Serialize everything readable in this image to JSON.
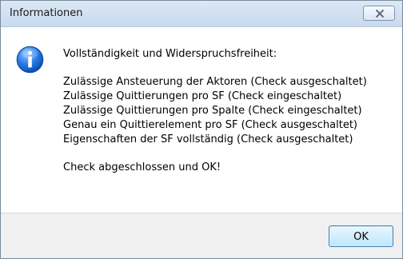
{
  "window": {
    "title": "Informationen"
  },
  "message": {
    "heading": "Vollständigkeit und Widerspruchsfreiheit:",
    "checks": [
      "Zulässige Ansteuerung der Aktoren (Check ausgeschaltet)",
      "Zulässige Quittierungen pro SF (Check eingeschaltet)",
      "Zulässige Quittierungen pro Spalte (Check eingeschaltet)",
      "Genau ein Quittierelement pro SF (Check ausgeschaltet)",
      "Eigenschaften der SF vollständig (Check ausgeschaltet)"
    ],
    "result": "Check abgeschlossen und OK!"
  },
  "buttons": {
    "ok_label": "OK"
  },
  "icons": {
    "close": "close-icon",
    "info": "info-icon"
  },
  "colors": {
    "titlebar": "#c8daee",
    "footer": "#f0f0f0",
    "info_icon": "#1f6fd1",
    "ok_border": "#3c7fb1"
  }
}
